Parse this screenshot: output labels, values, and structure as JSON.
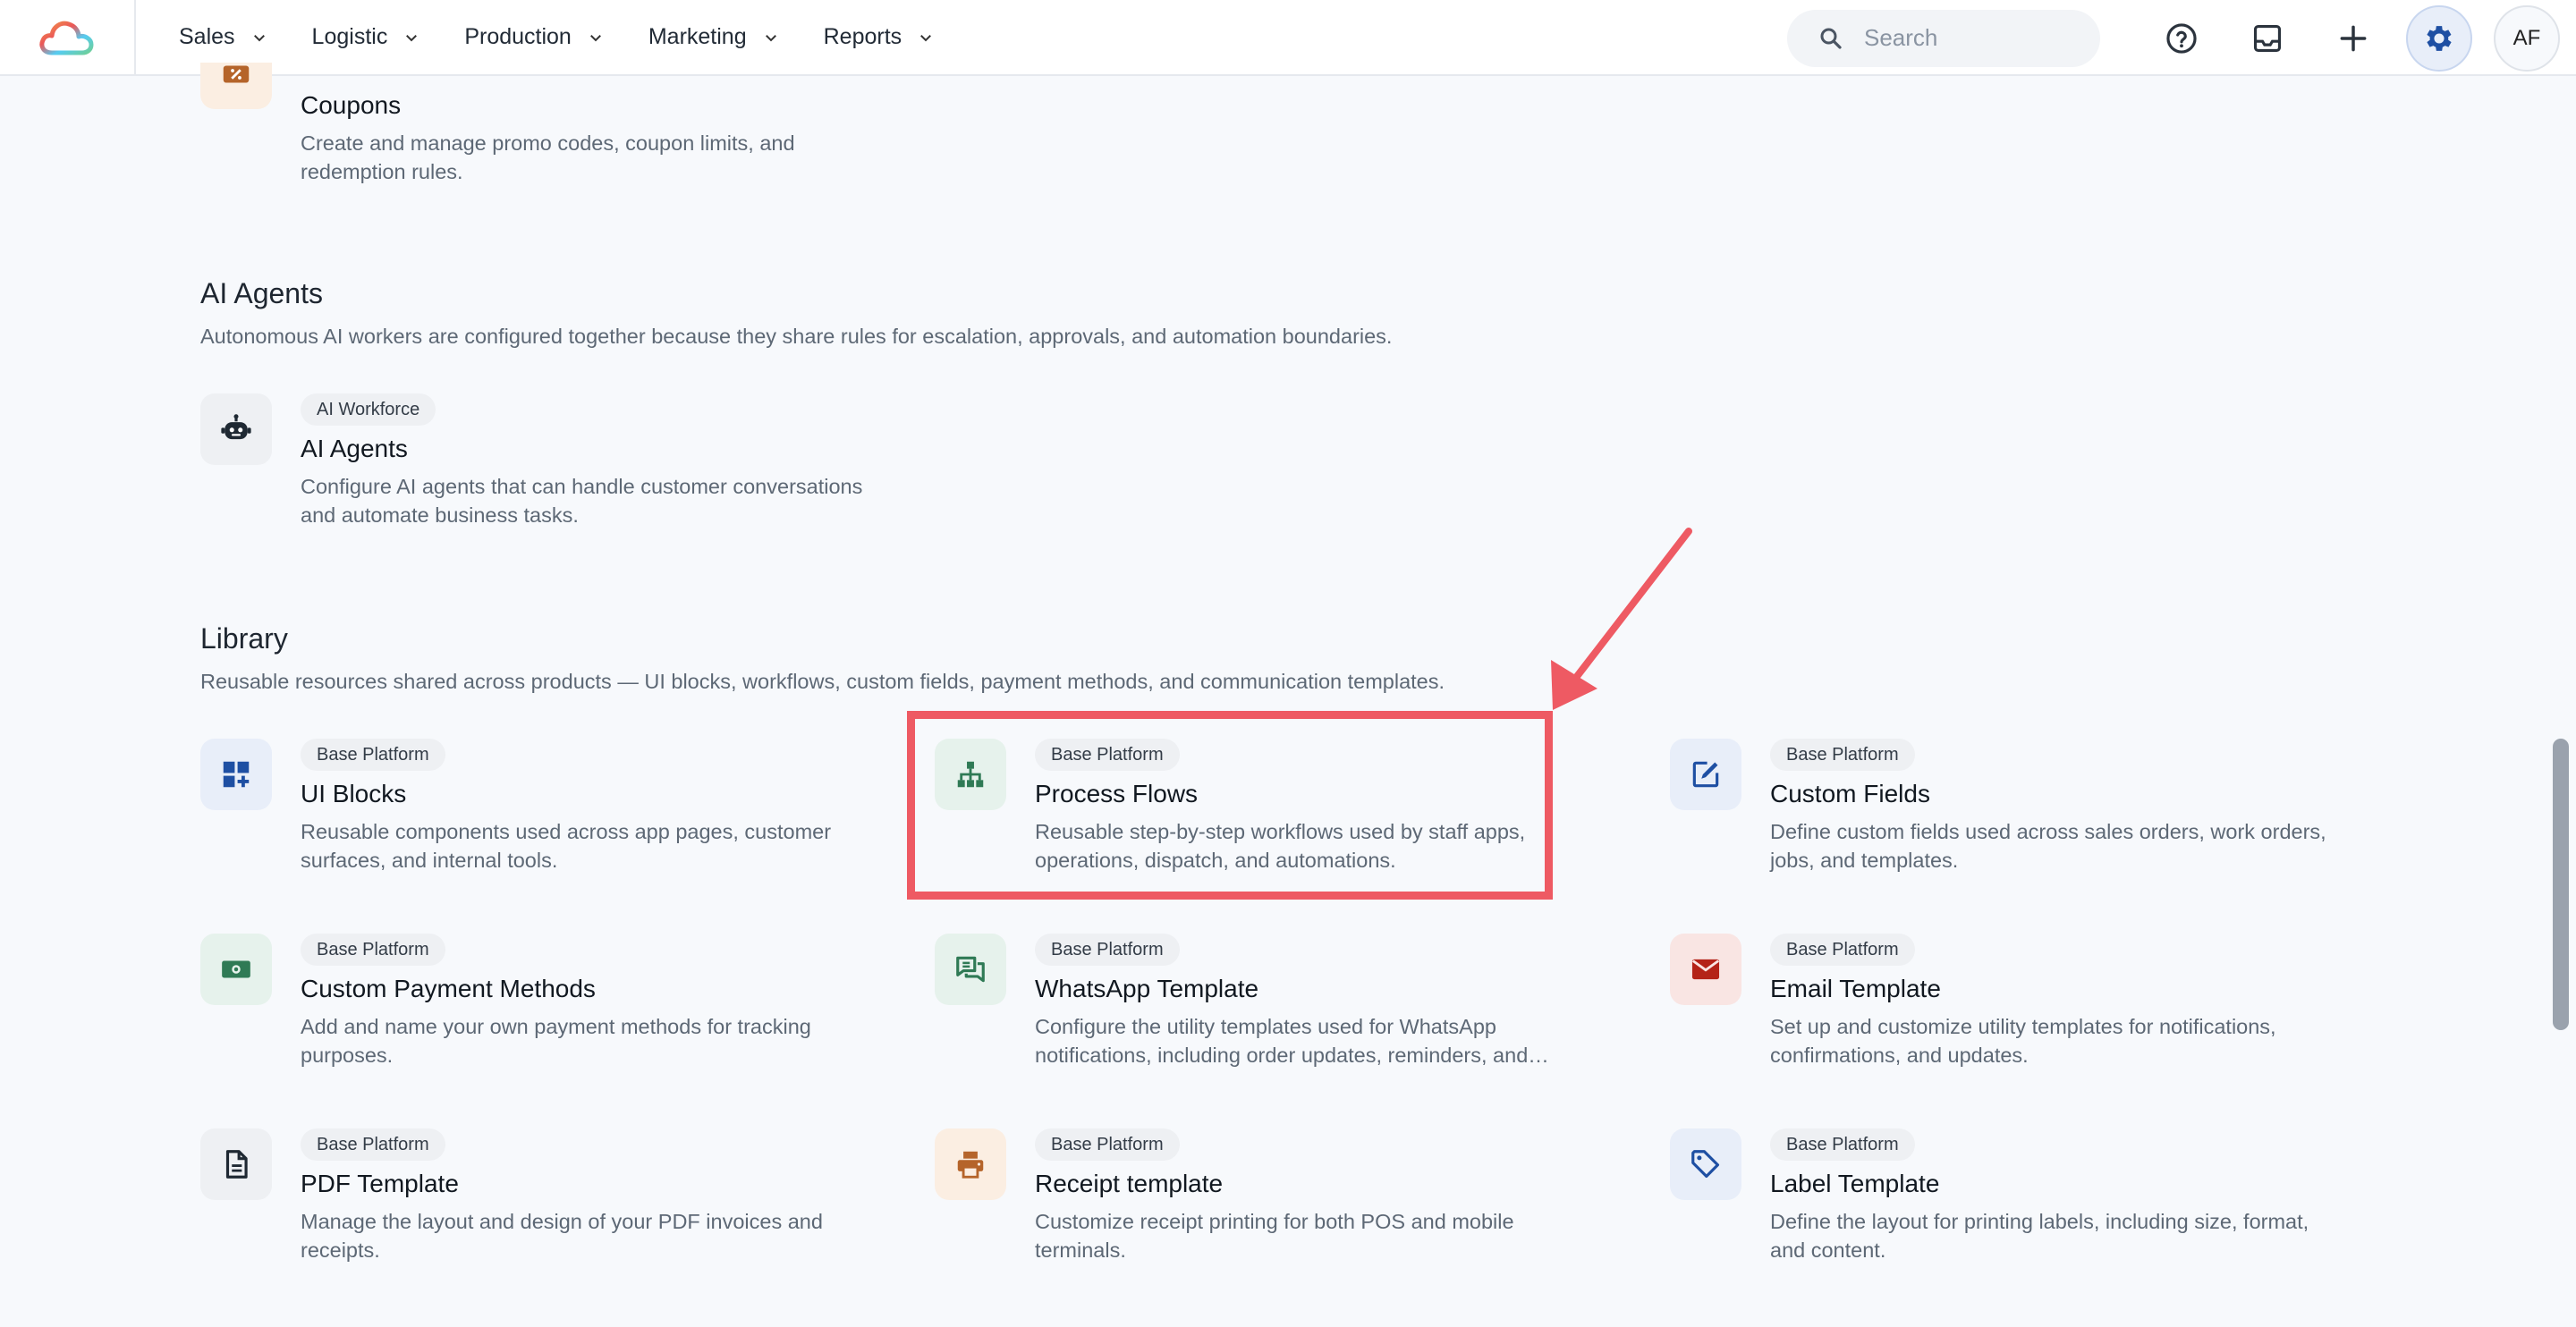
{
  "nav": {
    "items": [
      {
        "label": "Sales"
      },
      {
        "label": "Logistic"
      },
      {
        "label": "Production"
      },
      {
        "label": "Marketing"
      },
      {
        "label": "Reports"
      }
    ],
    "search_placeholder": "Search",
    "avatar_initials": "AF"
  },
  "coupons": {
    "title": "Coupons",
    "desc": "Create and manage promo codes, coupon limits, and redemption rules.",
    "icon": "ticket-percent-icon"
  },
  "ai_section": {
    "title": "AI Agents",
    "desc": "Autonomous AI workers are configured together because they share rules for escalation, approvals, and automation boundaries.",
    "cards": [
      {
        "badge": "AI Workforce",
        "title": "AI Agents",
        "desc": "Configure AI agents that can handle customer conversations and automate business tasks.",
        "icon": "robot-icon"
      }
    ]
  },
  "library_section": {
    "title": "Library",
    "desc": "Reusable resources shared across products — UI blocks, workflows, custom fields, payment methods, and communication templates.",
    "cards": [
      {
        "badge": "Base Platform",
        "title": "UI Blocks",
        "desc": "Reusable components used across app pages, customer surfaces, and internal tools.",
        "icon": "dashboard-add-icon"
      },
      {
        "badge": "Base Platform",
        "title": "Process Flows",
        "desc": "Reusable step-by-step workflows used by staff apps, operations, dispatch, and automations.",
        "icon": "sitemap-icon"
      },
      {
        "badge": "Base Platform",
        "title": "Custom Fields",
        "desc": "Define custom fields used across sales orders, work orders, jobs, and templates.",
        "icon": "edit-square-icon"
      },
      {
        "badge": "Base Platform",
        "title": "Custom Payment Methods",
        "desc": "Add and name your own payment methods for tracking purposes.",
        "icon": "cash-icon"
      },
      {
        "badge": "Base Platform",
        "title": "WhatsApp Template",
        "desc": "Configure the utility templates used for WhatsApp notifications, including order updates, reminders, and…",
        "icon": "chat-bubbles-icon"
      },
      {
        "badge": "Base Platform",
        "title": "Email Template",
        "desc": "Set up and customize utility templates for notifications, confirmations, and updates.",
        "icon": "mail-icon"
      },
      {
        "badge": "Base Platform",
        "title": "PDF Template",
        "desc": "Manage the layout and design of your PDF invoices and receipts.",
        "icon": "document-icon"
      },
      {
        "badge": "Base Platform",
        "title": "Receipt template",
        "desc": "Customize receipt printing for both POS and mobile terminals.",
        "icon": "printer-icon"
      },
      {
        "badge": "Base Platform",
        "title": "Label Template",
        "desc": "Define the layout for printing labels, including size, format, and content.",
        "icon": "tag-icon"
      }
    ]
  },
  "colors": {
    "highlight": "#ee5a63",
    "accent": "#1e4fa3",
    "green": "#2f7a55",
    "red": "#b42318",
    "orange": "#b5642a"
  }
}
